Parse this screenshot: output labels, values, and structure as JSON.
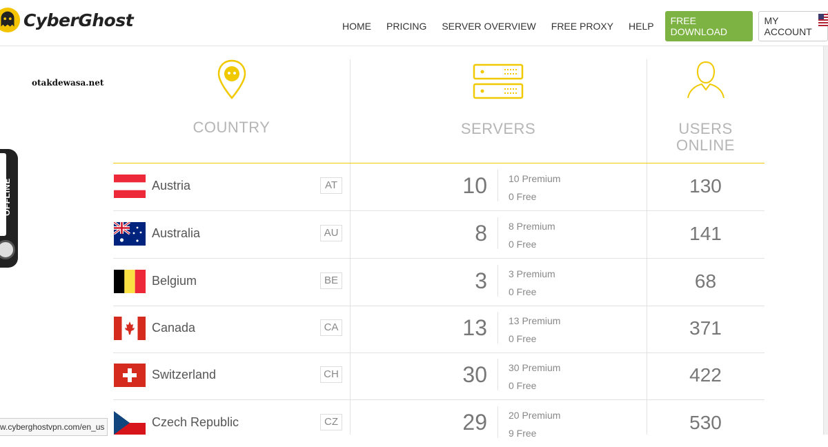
{
  "header": {
    "brand": "CyberGhost",
    "nav": [
      "HOME",
      "PRICING",
      "SERVER OVERVIEW",
      "FREE PROXY",
      "HELP"
    ],
    "download_label": "FREE DOWNLOAD",
    "account_label": "MY ACCOUNT"
  },
  "watermark": "otakdewasa.net",
  "offline_tab": "OFFLINE",
  "status_url": "w.cyberghostvpn.com/en_us",
  "columns": {
    "country": "COUNTRY",
    "servers": "SERVERS",
    "users_line1": "USERS",
    "users_line2": "ONLINE"
  },
  "colors": {
    "accent": "#f0c900",
    "download": "#7cb342"
  },
  "rows": [
    {
      "country": "Austria",
      "code": "AT",
      "flag": "flag-austria",
      "servers": "10",
      "premium": "10 Premium",
      "free": "0 Free",
      "users": "130"
    },
    {
      "country": "Australia",
      "code": "AU",
      "flag": "flag-australia",
      "servers": "8",
      "premium": "8 Premium",
      "free": "0 Free",
      "users": "141"
    },
    {
      "country": "Belgium",
      "code": "BE",
      "flag": "flag-belgium",
      "servers": "3",
      "premium": "3 Premium",
      "free": "0 Free",
      "users": "68"
    },
    {
      "country": "Canada",
      "code": "CA",
      "flag": "flag-canada",
      "servers": "13",
      "premium": "13 Premium",
      "free": "0 Free",
      "users": "371"
    },
    {
      "country": "Switzerland",
      "code": "CH",
      "flag": "flag-switzerland",
      "servers": "30",
      "premium": "30 Premium",
      "free": "0 Free",
      "users": "422"
    },
    {
      "country": "Czech Republic",
      "code": "CZ",
      "flag": "flag-czech",
      "servers": "29",
      "premium": "20 Premium",
      "free": "9 Free",
      "users": "530"
    }
  ]
}
